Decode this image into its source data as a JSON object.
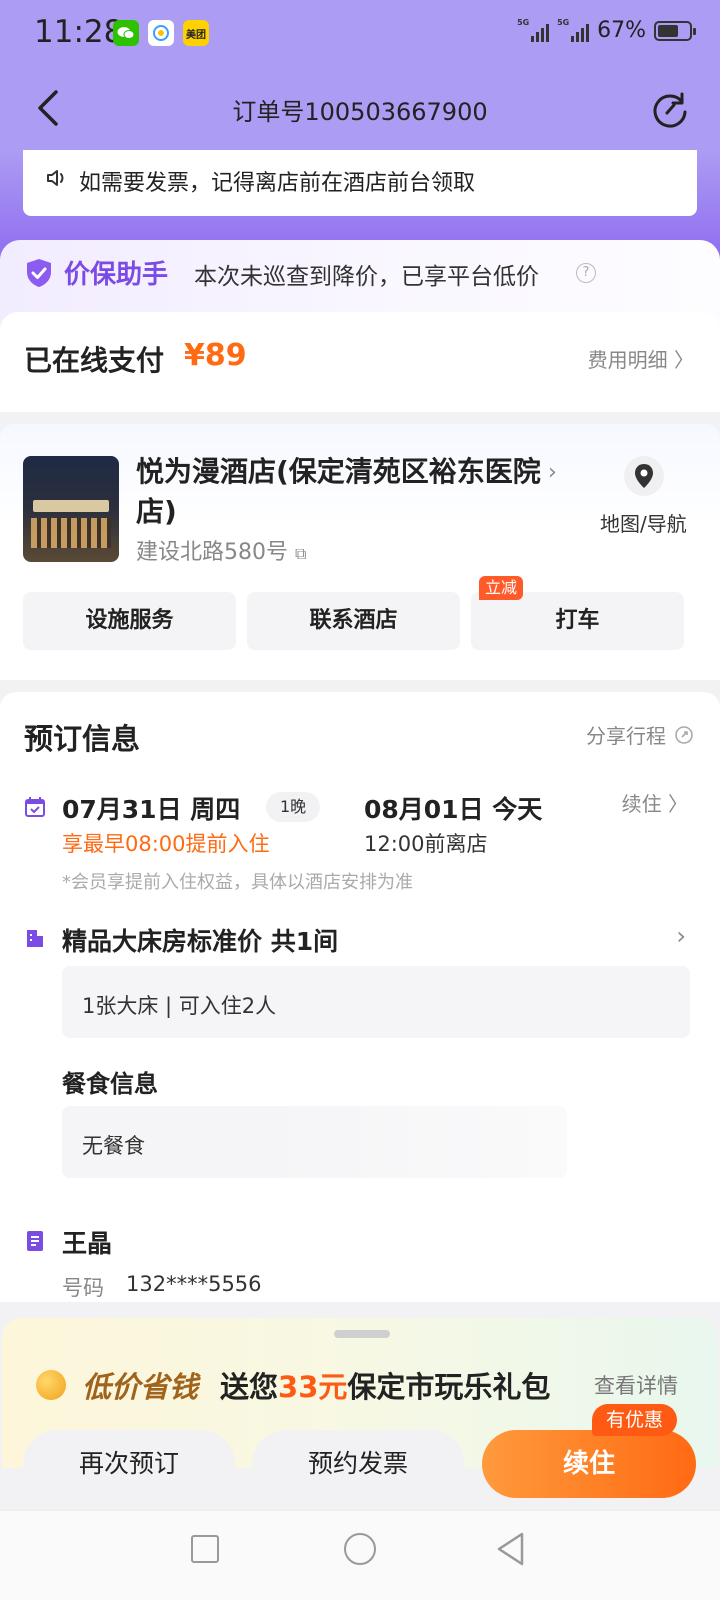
{
  "status_bar": {
    "time": "11:28",
    "apps": [
      "wechat-icon",
      "qq-icon",
      "meituan-icon"
    ],
    "meituan_label": "美团",
    "network1": "5G",
    "network2": "5G",
    "battery": "67%",
    "battery_level": 0.67
  },
  "nav": {
    "title": "订单号100503667900"
  },
  "notice": {
    "text": "如需要发票，记得离店前在酒店前台领取"
  },
  "price_guard": {
    "title": "价保助手",
    "text": "本次未巡查到降价，已享平台低价",
    "help": "?"
  },
  "payment": {
    "label": "已在线支付",
    "price": "¥89",
    "detail_link": "费用明细 〉"
  },
  "hotel": {
    "name": "悦为漫酒店(保定清苑区裕东医院店)",
    "address": "建设北路580号",
    "map_label": "地图/导航",
    "actions": [
      "设施服务",
      "联系酒店",
      "打车"
    ],
    "taxi_badge": "立减"
  },
  "booking": {
    "title": "预订信息",
    "share": "分享行程",
    "checkin_date": "07月31日 周四",
    "nights": "1晚",
    "checkout_date": "08月01日 今天",
    "renew_link": "续住 〉",
    "early_checkin": "享最早08:00提前入住",
    "checkout_time": "12:00前离店",
    "member_note": "*会员享提前入住权益，具体以酒店安排为准",
    "room_title": "精品大床房标准价 共1间",
    "room_detail": "1张大床 | 可入住2人",
    "meal_title": "餐食信息",
    "meal_value": "无餐食",
    "guest_name": "王晶",
    "phone_label": "号码",
    "phone_value": "132****5556"
  },
  "promo": {
    "slogan": "低价省钱",
    "text_prefix": "送您",
    "amount": "33元",
    "text_suffix": "保定市玩乐礼包",
    "more": "查看详情"
  },
  "bottom": {
    "rebook": "再次预订",
    "invoice": "预约发票",
    "renew": "续住",
    "renew_badge": "有优惠"
  },
  "colors": {
    "brand_purple": "#7b4ce4",
    "accent_orange": "#ff6a13",
    "header_purple": "#ad9cf3"
  }
}
